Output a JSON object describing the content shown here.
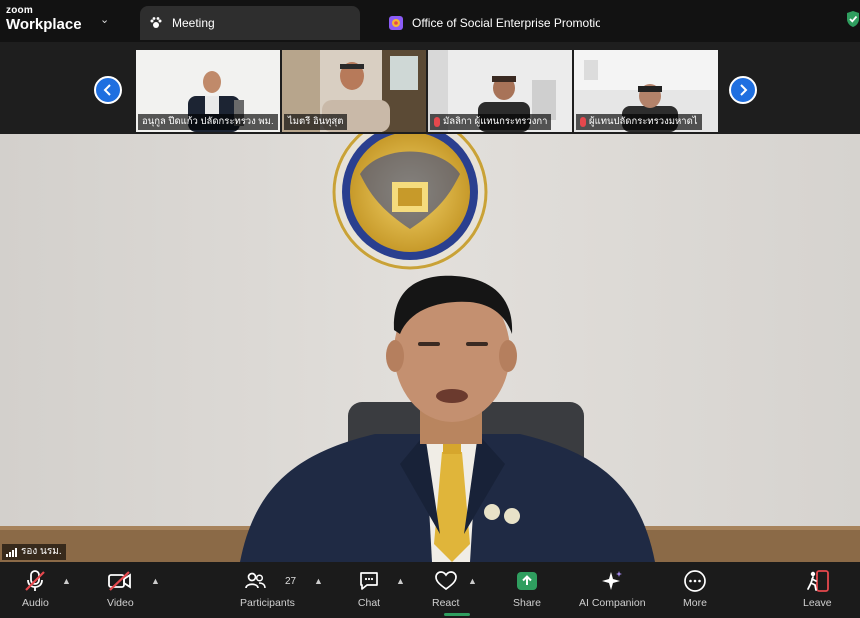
{
  "app": {
    "brand_small": "zoom",
    "brand_large": "Workplace"
  },
  "tabs": [
    {
      "label": "Meeting",
      "icon": "paw-icon",
      "active": true
    },
    {
      "label": "Office of Social Enterprise Promotion (",
      "icon": "app-icon",
      "active": false
    }
  ],
  "gallery": {
    "participants": [
      {
        "name": "อนุกูล ปีดแก้ว ปลัดกระทรวง พม.",
        "muted": false
      },
      {
        "name": "ไมตรี อินทุสุต",
        "muted": false
      },
      {
        "name": "มัลลิกา ผู้แทนกระทรวงกา",
        "muted": true
      },
      {
        "name": "ผู้แทนปลัดกระทรวงมหาดไ",
        "muted": true
      }
    ]
  },
  "main": {
    "speaker_name": "รอง นรม."
  },
  "toolbar": {
    "audio": "Audio",
    "video": "Video",
    "participants": "Participants",
    "participants_count": "27",
    "chat": "Chat",
    "react": "React",
    "share": "Share",
    "ai_companion": "AI Companion",
    "more": "More",
    "leave": "Leave"
  },
  "colors": {
    "accent_blue": "#1f6fe0",
    "share_green": "#2f9e5f",
    "leave_red": "#e5484d"
  }
}
